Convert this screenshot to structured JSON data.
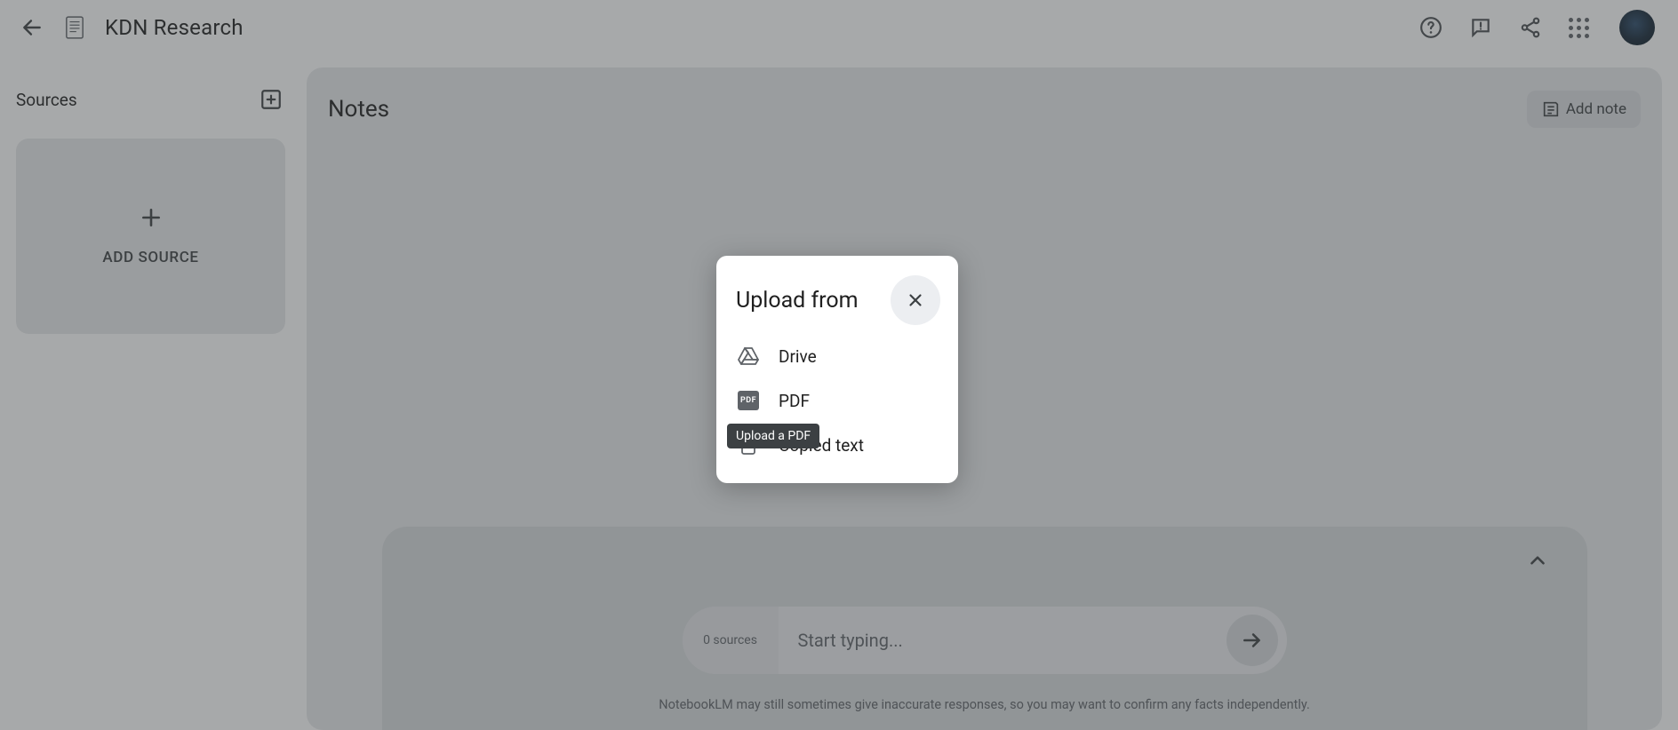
{
  "header": {
    "title": "KDN Research"
  },
  "sidebar": {
    "title": "Sources",
    "add_source_label": "ADD SOURCE"
  },
  "notes": {
    "title": "Notes",
    "add_note_label": "Add note"
  },
  "composer": {
    "sources_count_label": "0 sources",
    "placeholder": "Start typing...",
    "disclaimer": "NotebookLM may still sometimes give inaccurate responses, so you may want to confirm any facts independently."
  },
  "dialog": {
    "title": "Upload from",
    "items": {
      "drive": "Drive",
      "pdf": "PDF",
      "copied_text": "Copied text"
    }
  },
  "tooltip": {
    "pdf": "Upload a PDF"
  },
  "icons": {
    "pdf_badge": "PDF"
  }
}
